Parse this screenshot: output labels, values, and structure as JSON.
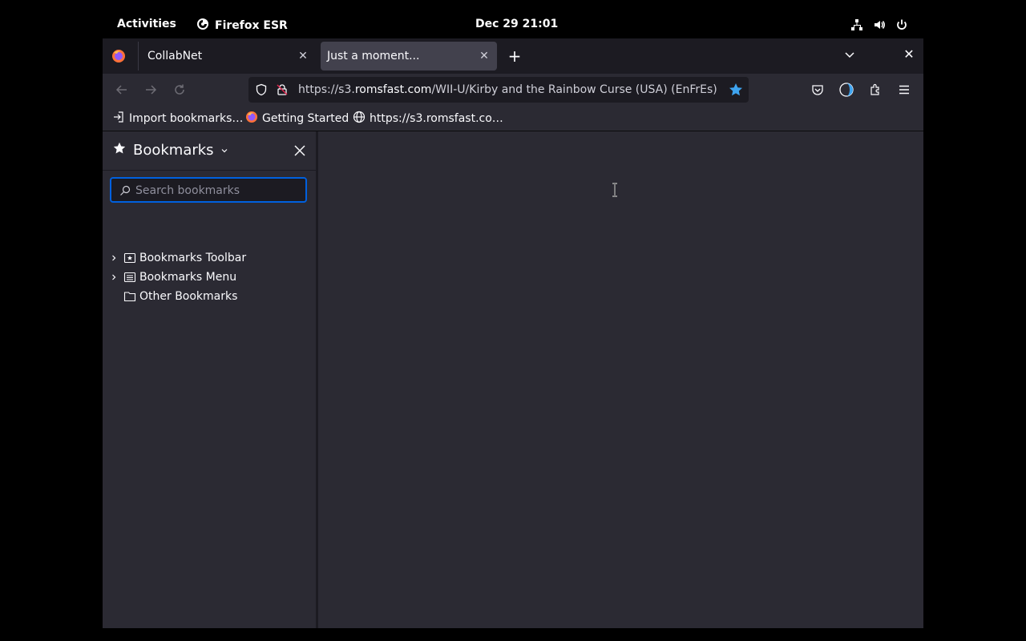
{
  "topbar": {
    "activities": "Activities",
    "app_name": "Firefox ESR",
    "clock": "Dec 29  21:01"
  },
  "tabs": [
    {
      "title": "CollabNet"
    },
    {
      "title": "Just a moment..."
    }
  ],
  "url": {
    "prefix": "https://s3.",
    "host": "romsfast.com",
    "path": "/WII-U/Kirby and the Rainbow Curse (USA) (EnFrEs).zip"
  },
  "bookmarks_bar": [
    {
      "label": "Import bookmarks…",
      "icon": "import-icon"
    },
    {
      "label": "Getting Started",
      "icon": "firefox-icon"
    },
    {
      "label": "https://s3.romsfast.co…",
      "icon": "globe-icon"
    }
  ],
  "sidebar": {
    "title": "Bookmarks",
    "search_placeholder": "Search bookmarks",
    "items": [
      {
        "label": "Bookmarks Toolbar"
      },
      {
        "label": "Bookmarks Menu"
      },
      {
        "label": "Other Bookmarks"
      }
    ]
  },
  "colors": {
    "accent": "#0060df",
    "star": "#3ea4f0"
  }
}
